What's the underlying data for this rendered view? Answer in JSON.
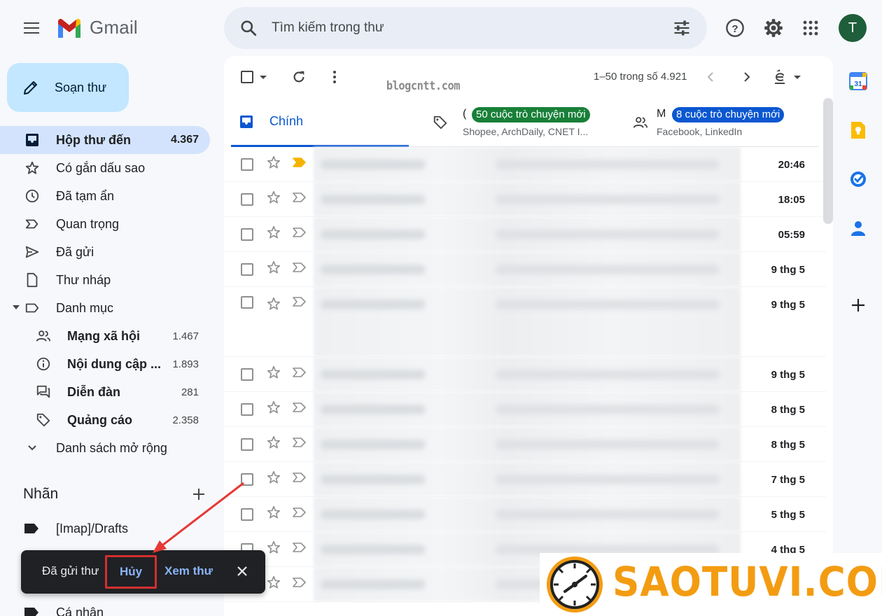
{
  "app": {
    "name": "Gmail",
    "avatar_letter": "T"
  },
  "search": {
    "placeholder": "Tìm kiếm trong thư"
  },
  "compose": {
    "label": "Soạn thư"
  },
  "sidebar": {
    "items": [
      {
        "label": "Hộp thư đến",
        "count": "4.367",
        "icon": "inbox-icon",
        "active": true
      },
      {
        "label": "Có gắn dấu sao",
        "count": "",
        "icon": "star-icon"
      },
      {
        "label": "Đã tạm ẩn",
        "count": "",
        "icon": "clock-icon"
      },
      {
        "label": "Quan trọng",
        "count": "",
        "icon": "important-icon"
      },
      {
        "label": "Đã gửi",
        "count": "",
        "icon": "send-icon"
      },
      {
        "label": "Thư nháp",
        "count": "",
        "icon": "draft-icon"
      },
      {
        "label": "Danh mục",
        "count": "",
        "icon": "label-outline-icon"
      }
    ],
    "categories": [
      {
        "label": "Mạng xã hội",
        "count": "1.467",
        "icon": "people-icon"
      },
      {
        "label": "Nội dung cập ...",
        "count": "1.893",
        "icon": "info-icon"
      },
      {
        "label": "Diễn đàn",
        "count": "281",
        "icon": "forum-icon"
      },
      {
        "label": "Quảng cáo",
        "count": "2.358",
        "icon": "tag-icon"
      }
    ],
    "more": "Danh sách mở rộng",
    "labels_title": "Nhãn",
    "labels": [
      {
        "label": "[Imap]/Drafts"
      },
      {
        "label": "Cá nhân"
      }
    ]
  },
  "toolbar": {
    "pager": "1–50 trong số 4.921"
  },
  "watermark": "blogcntt.com",
  "tabs": {
    "primary": {
      "label": "Chính"
    },
    "promotions": {
      "title_initial": "(",
      "badge": "50 cuộc trò chuyện mới",
      "subtitle": "Shopee, ArchDaily, CNET I...",
      "badge_color": "#188038"
    },
    "social": {
      "title_initial": "M",
      "badge": "8 cuộc trò chuyện mới",
      "subtitle": "Facebook, LinkedIn",
      "badge_color": "#0b57d0"
    }
  },
  "emails": [
    {
      "date": "20:46",
      "important": true
    },
    {
      "date": "18:05"
    },
    {
      "date": "05:59"
    },
    {
      "date": "9 thg 5"
    },
    {
      "date": "9 thg 5",
      "tall": true
    },
    {
      "date": "9 thg 5"
    },
    {
      "date": "8 thg 5"
    },
    {
      "date": "8 thg 5"
    },
    {
      "date": "7 thg 5"
    },
    {
      "date": "5 thg 5"
    },
    {
      "date": "4 thg 5"
    },
    {
      "date": ""
    }
  ],
  "snackbar": {
    "message": "Đã gửi thư",
    "undo": "Hủy",
    "view": "Xem thư"
  },
  "brand": {
    "text": "SAOTUVI.COM",
    "color": "#f39c12"
  }
}
